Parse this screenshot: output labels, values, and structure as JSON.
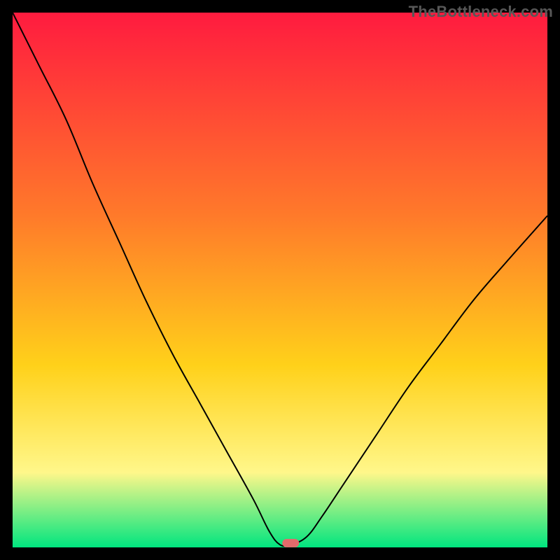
{
  "watermark": "TheBottleneck.com",
  "colors": {
    "gradient_top": "#ff1b3f",
    "gradient_mid1": "#ff7a2a",
    "gradient_mid2": "#ffd11a",
    "gradient_mid3": "#fff78a",
    "gradient_bottom": "#00e57f",
    "curve": "#000000",
    "marker": "#e36a6b",
    "frame": "#000000"
  },
  "chart_data": {
    "type": "line",
    "title": "",
    "xlabel": "",
    "ylabel": "",
    "xlim": [
      0,
      100
    ],
    "ylim": [
      0,
      100
    ],
    "grid": false,
    "legend": false,
    "series": [
      {
        "name": "bottleneck-curve",
        "x": [
          0,
          5,
          10,
          15,
          20,
          25,
          30,
          35,
          40,
          45,
          48,
          50,
          52,
          55,
          58,
          62,
          68,
          74,
          80,
          86,
          92,
          100
        ],
        "y": [
          100,
          90,
          80,
          68,
          57,
          46,
          36,
          27,
          18,
          9,
          3,
          0.5,
          0.5,
          2,
          6,
          12,
          21,
          30,
          38,
          46,
          53,
          62
        ]
      }
    ],
    "marker": {
      "x": 52,
      "y": 0.8
    },
    "notes": "Background is a vertical heat gradient (red→orange→yellow→green). Axes and ticks are not labeled; values are estimated on a 0–100 normalized scale."
  }
}
